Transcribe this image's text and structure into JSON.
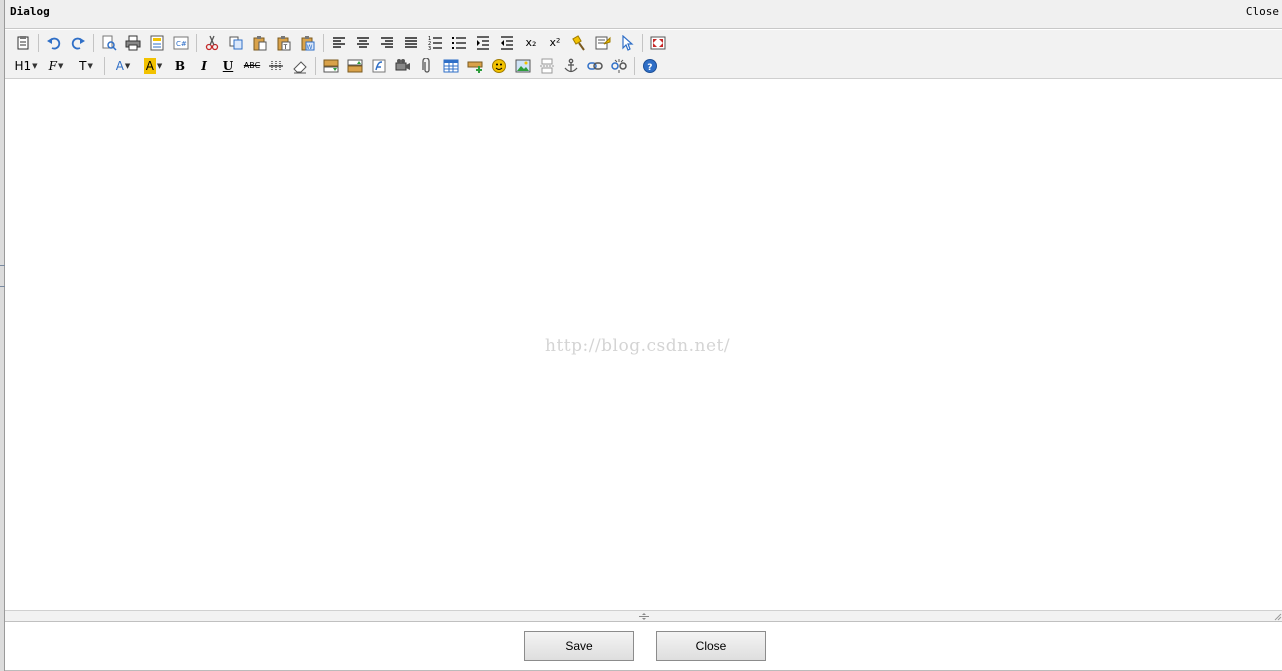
{
  "dialog": {
    "title": "Dialog",
    "close_link": "Close"
  },
  "toolbar": {
    "heading_label": "H1",
    "font_family_label": "F",
    "font_size_label": "T",
    "font_color_label": "A",
    "bg_color_label": "A",
    "bold_label": "B",
    "italic_label": "I",
    "underline_label": "U",
    "strike_label": "ABC",
    "subscript_label": "x₂",
    "superscript_label": "x²"
  },
  "editor": {
    "watermark": "http://blog.csdn.net/"
  },
  "footer": {
    "save_label": "Save",
    "close_label": "Close"
  },
  "colors": {
    "icon_blue": "#2f6fc7",
    "icon_yellow": "#f2c200",
    "icon_red": "#c62828"
  }
}
